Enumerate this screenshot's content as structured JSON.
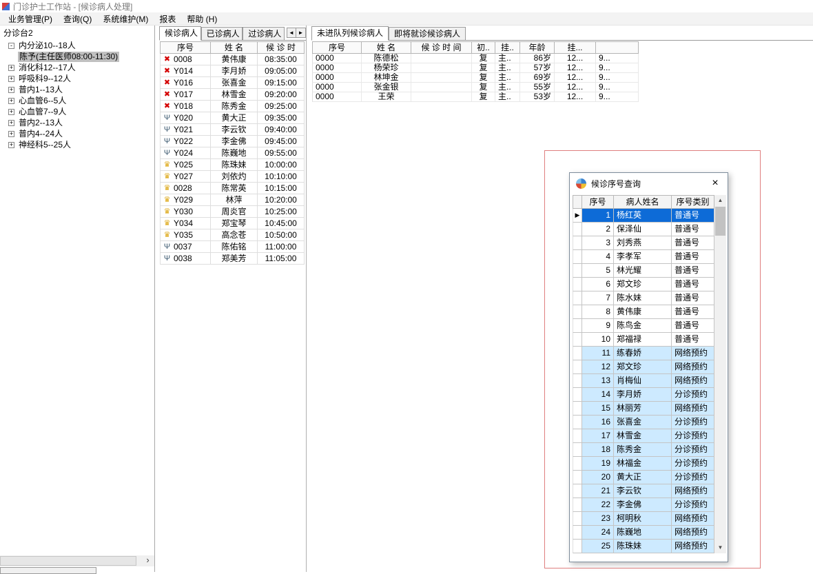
{
  "window": {
    "title": "门诊护士工作站 - [候诊病人处理]"
  },
  "menu": {
    "items": [
      "业务管理(P)",
      "查询(Q)",
      "系统维护(M)",
      "报表",
      "帮助 (H)"
    ]
  },
  "icons": {
    "expand-plus": "+",
    "expand-minus": "-",
    "tab-scroll-left": "◄",
    "tab-scroll-right": "►",
    "scroll-up": "▲",
    "scroll-down": "▼",
    "scroll-right": "›",
    "close": "×",
    "row-indicator": "▶",
    "status-x": "✖",
    "status-fork": "Ψ",
    "status-trophy": "♛"
  },
  "colors": {
    "selection_bg": "#0d6bd7",
    "selection_text": "#ffffff",
    "reserved_row_bg": "#cdeaff",
    "highlight_border": "#df7e7e",
    "tree_selected_bg": "#c0c0c0",
    "status_x": "#d40000",
    "status_fork": "#3d5a70",
    "status_trophy": "#dca50f"
  },
  "tree": {
    "root": "分诊台2",
    "items": [
      {
        "label": "内分泌10--18人",
        "expand": "minus",
        "level": 1,
        "selected": false
      },
      {
        "label": "陈予(主任医师08:00-11:30)",
        "expand": "none",
        "level": 2,
        "selected": true
      },
      {
        "label": "消化科12--17人",
        "expand": "plus",
        "level": 1,
        "selected": false
      },
      {
        "label": "呼吸科9--12人",
        "expand": "plus",
        "level": 1,
        "selected": false
      },
      {
        "label": "普内1--13人",
        "expand": "plus",
        "level": 1,
        "selected": false
      },
      {
        "label": "心血管6--5人",
        "expand": "plus",
        "level": 1,
        "selected": false
      },
      {
        "label": "心血管7--9人",
        "expand": "plus",
        "level": 1,
        "selected": false
      },
      {
        "label": "普内2--13人",
        "expand": "plus",
        "level": 1,
        "selected": false
      },
      {
        "label": "普内4--24人",
        "expand": "plus",
        "level": 1,
        "selected": false
      },
      {
        "label": "神经科5--25人",
        "expand": "plus",
        "level": 1,
        "selected": false
      }
    ]
  },
  "waiting_panel": {
    "tabs": [
      "候诊病人",
      "已诊病人",
      "过诊病人"
    ],
    "active_tab": 0,
    "columns": [
      "序号",
      "姓  名",
      "候 诊 时"
    ],
    "rows": [
      {
        "icon": "x",
        "no": "0008",
        "name": "黄伟康",
        "time": "08:35:00"
      },
      {
        "icon": "x",
        "no": "Y014",
        "name": "李月娇",
        "time": "09:05:00"
      },
      {
        "icon": "x",
        "no": "Y016",
        "name": "张喜金",
        "time": "09:15:00"
      },
      {
        "icon": "x",
        "no": "Y017",
        "name": "林雪金",
        "time": "09:20:00"
      },
      {
        "icon": "x",
        "no": "Y018",
        "name": "陈秀金",
        "time": "09:25:00"
      },
      {
        "icon": "fork",
        "no": "Y020",
        "name": "黄大正",
        "time": "09:35:00"
      },
      {
        "icon": "fork",
        "no": "Y021",
        "name": "李云钦",
        "time": "09:40:00"
      },
      {
        "icon": "fork",
        "no": "Y022",
        "name": "李金佛",
        "time": "09:45:00"
      },
      {
        "icon": "fork",
        "no": "Y024",
        "name": "陈巍地",
        "time": "09:55:00"
      },
      {
        "icon": "trophy",
        "no": "Y025",
        "name": "陈珠妹",
        "time": "10:00:00"
      },
      {
        "icon": "trophy",
        "no": "Y027",
        "name": "刘依灼",
        "time": "10:10:00"
      },
      {
        "icon": "trophy",
        "no": "0028",
        "name": "陈常英",
        "time": "10:15:00"
      },
      {
        "icon": "trophy",
        "no": "Y029",
        "name": "林萍",
        "time": "10:20:00"
      },
      {
        "icon": "trophy",
        "no": "Y030",
        "name": "周炎官",
        "time": "10:25:00"
      },
      {
        "icon": "trophy",
        "no": "Y034",
        "name": "郑宝琴",
        "time": "10:45:00"
      },
      {
        "icon": "trophy",
        "no": "Y035",
        "name": "高念苍",
        "time": "10:50:00"
      },
      {
        "icon": "fork",
        "no": "0037",
        "name": "陈佑铭",
        "time": "11:00:00"
      },
      {
        "icon": "fork",
        "no": "0038",
        "name": "郑美芳",
        "time": "11:05:00"
      }
    ]
  },
  "queue_panel": {
    "tabs": [
      "未进队列候诊病人",
      "即将就诊候诊病人"
    ],
    "active_tab": 0,
    "columns": [
      "序号",
      "姓  名",
      "候 诊 时 间",
      "初..",
      "挂..",
      "年龄",
      "挂...",
      ""
    ],
    "rows": [
      {
        "no": "0000",
        "name": "陈德松",
        "time": "",
        "first": "复",
        "reg": "主..",
        "age": "86岁",
        "fee": "12...",
        "extra": "9..."
      },
      {
        "no": "0000",
        "name": "杨荣珍",
        "time": "",
        "first": "复",
        "reg": "主..",
        "age": "57岁",
        "fee": "12...",
        "extra": "9..."
      },
      {
        "no": "0000",
        "name": "林坤金",
        "time": "",
        "first": "复",
        "reg": "主..",
        "age": "69岁",
        "fee": "12...",
        "extra": "9..."
      },
      {
        "no": "0000",
        "name": "张金银",
        "time": "",
        "first": "复",
        "reg": "主..",
        "age": "55岁",
        "fee": "12...",
        "extra": "9..."
      },
      {
        "no": "0000",
        "name": "王荣",
        "time": "",
        "first": "复",
        "reg": "主..",
        "age": "53岁",
        "fee": "12...",
        "extra": "9..."
      }
    ]
  },
  "dialog": {
    "title": "候诊序号查询",
    "columns": [
      "序号",
      "病人姓名",
      "序号类别"
    ],
    "rows": [
      {
        "no": "1",
        "name": "杨红英",
        "type": "普通号",
        "selected": true
      },
      {
        "no": "2",
        "name": "保泽仙",
        "type": "普通号",
        "selected": false
      },
      {
        "no": "3",
        "name": "刘秀燕",
        "type": "普通号",
        "selected": false
      },
      {
        "no": "4",
        "name": "李孝军",
        "type": "普通号",
        "selected": false
      },
      {
        "no": "5",
        "name": "林光耀",
        "type": "普通号",
        "selected": false
      },
      {
        "no": "6",
        "name": "郑文珍",
        "type": "普通号",
        "selected": false
      },
      {
        "no": "7",
        "name": "陈水妹",
        "type": "普通号",
        "selected": false
      },
      {
        "no": "8",
        "name": "黄伟康",
        "type": "普通号",
        "selected": false
      },
      {
        "no": "9",
        "name": "陈鸟金",
        "type": "普通号",
        "selected": false
      },
      {
        "no": "10",
        "name": "郑福禄",
        "type": "普通号",
        "selected": false
      },
      {
        "no": "11",
        "name": "练春娇",
        "type": "网络预约",
        "selected": false
      },
      {
        "no": "12",
        "name": "郑文珍",
        "type": "网络预约",
        "selected": false
      },
      {
        "no": "13",
        "name": "肖梅仙",
        "type": "网络预约",
        "selected": false
      },
      {
        "no": "14",
        "name": "李月娇",
        "type": "分诊预约",
        "selected": false
      },
      {
        "no": "15",
        "name": "林丽芳",
        "type": "网络预约",
        "selected": false
      },
      {
        "no": "16",
        "name": "张喜金",
        "type": "分诊预约",
        "selected": false
      },
      {
        "no": "17",
        "name": "林雪金",
        "type": "分诊预约",
        "selected": false
      },
      {
        "no": "18",
        "name": "陈秀金",
        "type": "分诊预约",
        "selected": false
      },
      {
        "no": "19",
        "name": "林福金",
        "type": "分诊预约",
        "selected": false
      },
      {
        "no": "20",
        "name": "黄大正",
        "type": "分诊预约",
        "selected": false
      },
      {
        "no": "21",
        "name": "李云钦",
        "type": "网络预约",
        "selected": false
      },
      {
        "no": "22",
        "name": "李金佛",
        "type": "分诊预约",
        "selected": false
      },
      {
        "no": "23",
        "name": "柯明秋",
        "type": "网络预约",
        "selected": false
      },
      {
        "no": "24",
        "name": "陈巍地",
        "type": "网络预约",
        "selected": false
      },
      {
        "no": "25",
        "name": "陈珠妹",
        "type": "网络预约",
        "selected": false
      }
    ]
  }
}
